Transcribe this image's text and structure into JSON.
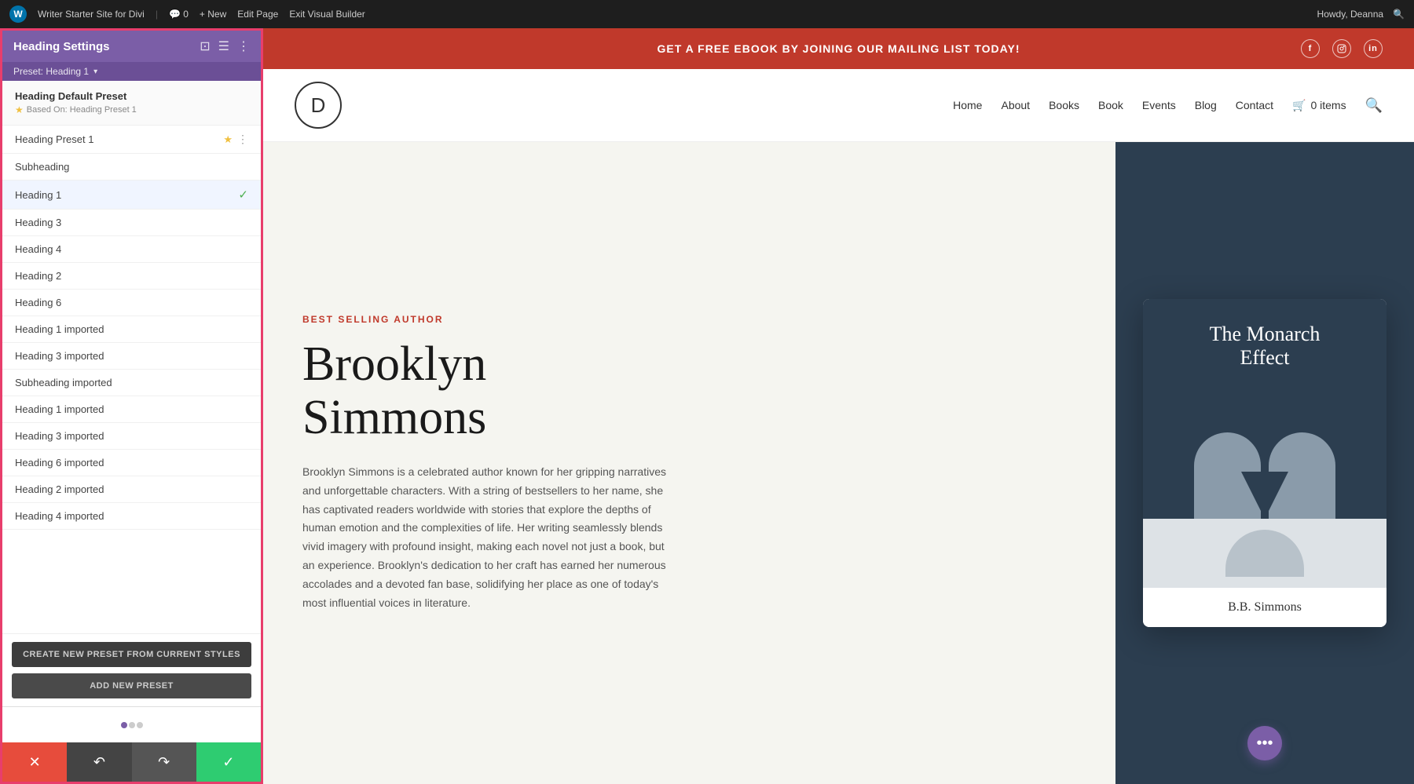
{
  "adminBar": {
    "logo": "W",
    "items": [
      "Writer Starter Site for Divi",
      "0",
      "+ New",
      "Edit Page",
      "Exit Visual Builder"
    ],
    "right": [
      "Howdy, Deanna",
      "🔍"
    ]
  },
  "leftPanel": {
    "title": "Heading Settings",
    "preset_label": "Preset: Heading 1",
    "default_preset": {
      "title": "Heading Default Preset",
      "subtitle": "Based On: Heading Preset 1"
    },
    "presets": [
      {
        "label": "Heading Preset 1",
        "starred": true,
        "active": false,
        "checked": false
      },
      {
        "label": "Subheading",
        "starred": false,
        "active": false,
        "checked": false
      },
      {
        "label": "Heading 1",
        "starred": false,
        "active": true,
        "checked": true
      },
      {
        "label": "Heading 3",
        "starred": false,
        "active": false,
        "checked": false
      },
      {
        "label": "Heading 4",
        "starred": false,
        "active": false,
        "checked": false
      },
      {
        "label": "Heading 2",
        "starred": false,
        "active": false,
        "checked": false
      },
      {
        "label": "Heading 6",
        "starred": false,
        "active": false,
        "checked": false
      },
      {
        "label": "Heading 1 imported",
        "starred": false,
        "active": false,
        "checked": false
      },
      {
        "label": "Heading 3 imported",
        "starred": false,
        "active": false,
        "checked": false
      },
      {
        "label": "Subheading imported",
        "starred": false,
        "active": false,
        "checked": false
      },
      {
        "label": "Heading 1 imported",
        "starred": false,
        "active": false,
        "checked": false
      },
      {
        "label": "Heading 3 imported",
        "starred": false,
        "active": false,
        "checked": false
      },
      {
        "label": "Heading 6 imported",
        "starred": false,
        "active": false,
        "checked": false
      },
      {
        "label": "Heading 2 imported",
        "starred": false,
        "active": false,
        "checked": false
      },
      {
        "label": "Heading 4 imported",
        "starred": false,
        "active": false,
        "checked": false
      }
    ],
    "btn_create": "CREATE NEW PRESET FROM CURRENT STYLES",
    "btn_add": "ADD NEW PRESET",
    "bottomBar": {
      "cancel": "✕",
      "undo": "↶",
      "redo": "↷",
      "confirm": "✓"
    }
  },
  "site": {
    "banner": "GET A FREE EBOOK BY JOINING OUR MAILING LIST TODAY!",
    "social": [
      "f",
      "◻",
      "in"
    ],
    "logo_letter": "D",
    "nav": {
      "links": [
        "Home",
        "About",
        "Books",
        "Book",
        "Events",
        "Blog",
        "Contact"
      ],
      "cart": "0 items"
    },
    "hero": {
      "tag": "BEST SELLING AUTHOR",
      "name": "Brooklyn\nSimmons",
      "bio": "Brooklyn Simmons is a celebrated author known for her gripping narratives and unforgettable characters. With a string of bestsellers to her name, she has captivated readers worldwide with stories that explore the depths of human emotion and the complexities of life. Her writing seamlessly blends vivid imagery with profound insight, making each novel not just a book, but an experience. Brooklyn's dedication to her craft has earned her numerous accolades and a devoted fan base, solidifying her place as one of today's most influential voices in literature."
    },
    "book": {
      "title": "The Monarch\nEffect",
      "author": "B.B. Simmons"
    }
  }
}
